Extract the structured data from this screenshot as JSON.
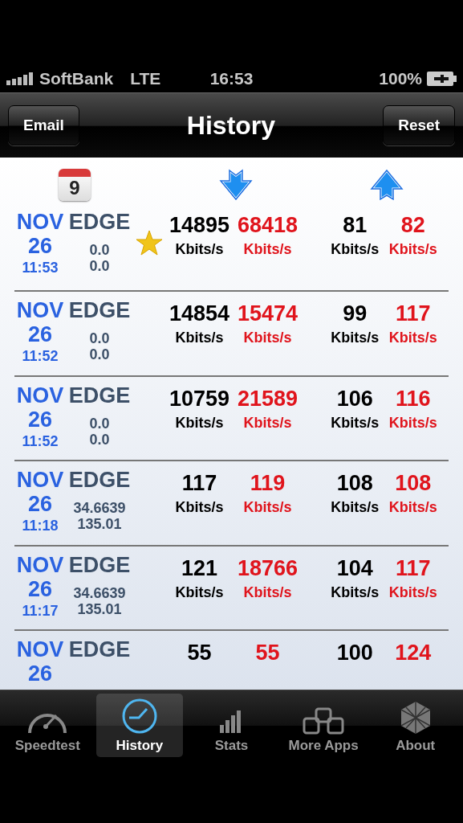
{
  "status_bar": {
    "carrier": "SoftBank",
    "network": "LTE",
    "time": "16:53",
    "battery": "100%"
  },
  "nav_bar": {
    "title": "History",
    "left_button": "Email",
    "right_button": "Reset"
  },
  "header": {
    "calendar_day": "9"
  },
  "rows": [
    {
      "month": "NOV",
      "day": "26",
      "time": "11:53",
      "network": "EDGE",
      "lat": "0.0",
      "lon": "0.0",
      "starred": true,
      "download": [
        {
          "kind": "plain",
          "value": "14895",
          "unit": "Kbits/s"
        },
        {
          "kind": "peak",
          "value": "68418",
          "unit": "Kbits/s"
        }
      ],
      "upload": [
        {
          "kind": "plain",
          "value": "81",
          "unit": "Kbits/s"
        },
        {
          "kind": "peak",
          "value": "82",
          "unit": "Kbits/s"
        }
      ]
    },
    {
      "month": "NOV",
      "day": "26",
      "time": "11:52",
      "network": "EDGE",
      "lat": "0.0",
      "lon": "0.0",
      "starred": false,
      "download": [
        {
          "kind": "plain",
          "value": "14854",
          "unit": "Kbits/s"
        },
        {
          "kind": "peak",
          "value": "15474",
          "unit": "Kbits/s"
        }
      ],
      "upload": [
        {
          "kind": "plain",
          "value": "99",
          "unit": "Kbits/s"
        },
        {
          "kind": "peak",
          "value": "117",
          "unit": "Kbits/s"
        }
      ]
    },
    {
      "month": "NOV",
      "day": "26",
      "time": "11:52",
      "network": "EDGE",
      "lat": "0.0",
      "lon": "0.0",
      "starred": false,
      "download": [
        {
          "kind": "plain",
          "value": "10759",
          "unit": "Kbits/s"
        },
        {
          "kind": "peak",
          "value": "21589",
          "unit": "Kbits/s"
        }
      ],
      "upload": [
        {
          "kind": "plain",
          "value": "106",
          "unit": "Kbits/s"
        },
        {
          "kind": "peak",
          "value": "116",
          "unit": "Kbits/s"
        }
      ]
    },
    {
      "month": "NOV",
      "day": "26",
      "time": "11:18",
      "network": "EDGE",
      "lat": "34.6639",
      "lon": "135.01",
      "starred": false,
      "download": [
        {
          "kind": "plain",
          "value": "117",
          "unit": "Kbits/s"
        },
        {
          "kind": "peak",
          "value": "119",
          "unit": "Kbits/s"
        }
      ],
      "upload": [
        {
          "kind": "plain",
          "value": "108",
          "unit": "Kbits/s"
        },
        {
          "kind": "peak",
          "value": "108",
          "unit": "Kbits/s"
        }
      ]
    },
    {
      "month": "NOV",
      "day": "26",
      "time": "11:17",
      "network": "EDGE",
      "lat": "34.6639",
      "lon": "135.01",
      "starred": false,
      "download": [
        {
          "kind": "plain",
          "value": "121",
          "unit": "Kbits/s"
        },
        {
          "kind": "peak",
          "value": "18766",
          "unit": "Kbits/s"
        }
      ],
      "upload": [
        {
          "kind": "plain",
          "value": "104",
          "unit": "Kbits/s"
        },
        {
          "kind": "peak",
          "value": "117",
          "unit": "Kbits/s"
        }
      ]
    },
    {
      "month": "NOV",
      "day": "26",
      "network": "EDGE",
      "starred": false,
      "download": [
        {
          "kind": "plain",
          "value": "55"
        },
        {
          "kind": "peak",
          "value": "55"
        }
      ],
      "upload": [
        {
          "kind": "plain",
          "value": "100"
        },
        {
          "kind": "peak",
          "value": "124"
        }
      ]
    }
  ],
  "tab_bar": [
    {
      "label": "Speedtest",
      "selected": false
    },
    {
      "label": "History",
      "selected": true
    },
    {
      "label": "Stats",
      "selected": false
    },
    {
      "label": "More Apps",
      "selected": false
    },
    {
      "label": "About",
      "selected": false
    }
  ]
}
